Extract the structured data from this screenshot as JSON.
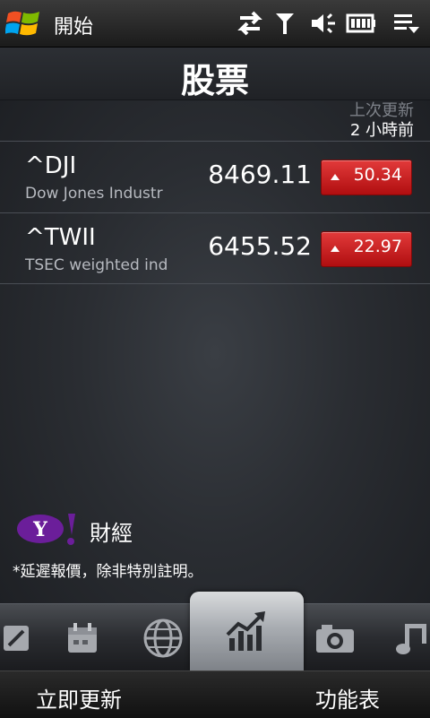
{
  "status_bar": {
    "start_label": "開始",
    "icons": [
      "windows-logo",
      "data-sync-icon",
      "signal-icon",
      "volume-icon",
      "battery-icon",
      "menu-icon"
    ]
  },
  "header": {
    "title": "股票",
    "last_update_label": "上次更新",
    "last_update_value": "2 小時前"
  },
  "stocks": [
    {
      "symbol": "^DJI",
      "name": "Dow Jones Industr",
      "price": "8469.11",
      "change": "50.34",
      "direction": "up"
    },
    {
      "symbol": "^TWII",
      "name": "TSEC weighted ind",
      "price": "6455.52",
      "change": "22.97",
      "direction": "up"
    }
  ],
  "footer": {
    "provider_label": "財經",
    "note": "*延遲報價，除非特別註明。"
  },
  "tabs": [
    {
      "icon": "notes-icon",
      "active": false
    },
    {
      "icon": "calendar-icon",
      "active": false
    },
    {
      "icon": "globe-icon",
      "active": false
    },
    {
      "icon": "stocks-chart-icon",
      "active": true
    },
    {
      "icon": "camera-icon",
      "active": false
    },
    {
      "icon": "music-icon",
      "active": false
    }
  ],
  "softkeys": {
    "left": "立即更新",
    "right": "功能表"
  },
  "colors": {
    "change_up": "#c8141a",
    "accent_logo": "#6b1e9a"
  }
}
